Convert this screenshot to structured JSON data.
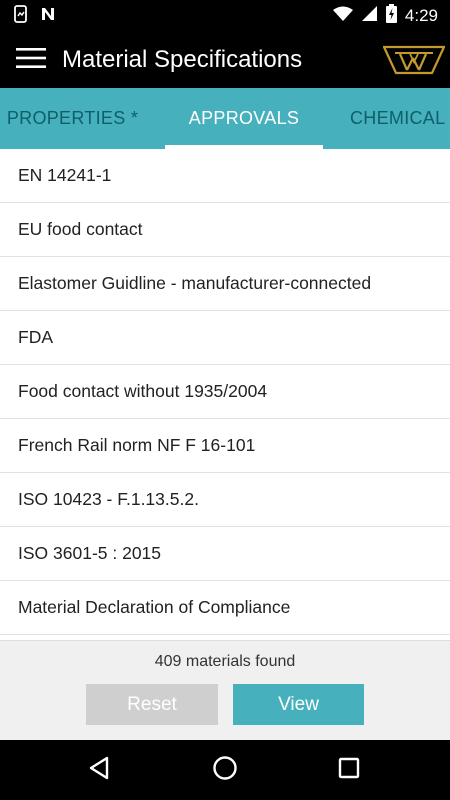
{
  "status_bar": {
    "time": "4:29",
    "icons": [
      "screenshot-icon",
      "n-app-icon",
      "wifi-icon",
      "signal-icon",
      "battery-charging-icon"
    ]
  },
  "app_bar": {
    "title": "Material Specifications",
    "menu_icon": "hamburger-menu-icon",
    "logo": "brand-logo"
  },
  "tabs": [
    {
      "label": "PROPERTIES *",
      "selected": false
    },
    {
      "label": "APPROVALS",
      "selected": true
    },
    {
      "label": "CHEMICAL",
      "selected": false
    }
  ],
  "approvals": [
    "EN 14241-1",
    "EU food contact",
    "Elastomer Guidline - manufacturer-connected",
    "FDA",
    "Food contact without 1935/2004",
    "French Rail norm NF F 16-101",
    "ISO 10423 - F.1.13.5.2.",
    "ISO 3601-5 : 2015",
    "Material Declaration of Compliance"
  ],
  "footer": {
    "count_text": "409 materials found",
    "reset_label": "Reset",
    "view_label": "View"
  },
  "colors": {
    "accent": "#46b1bd",
    "tab_inactive": "#0e5f68",
    "logo_gold": "#c49a2c",
    "reset_bg": "#cfcfcf"
  }
}
